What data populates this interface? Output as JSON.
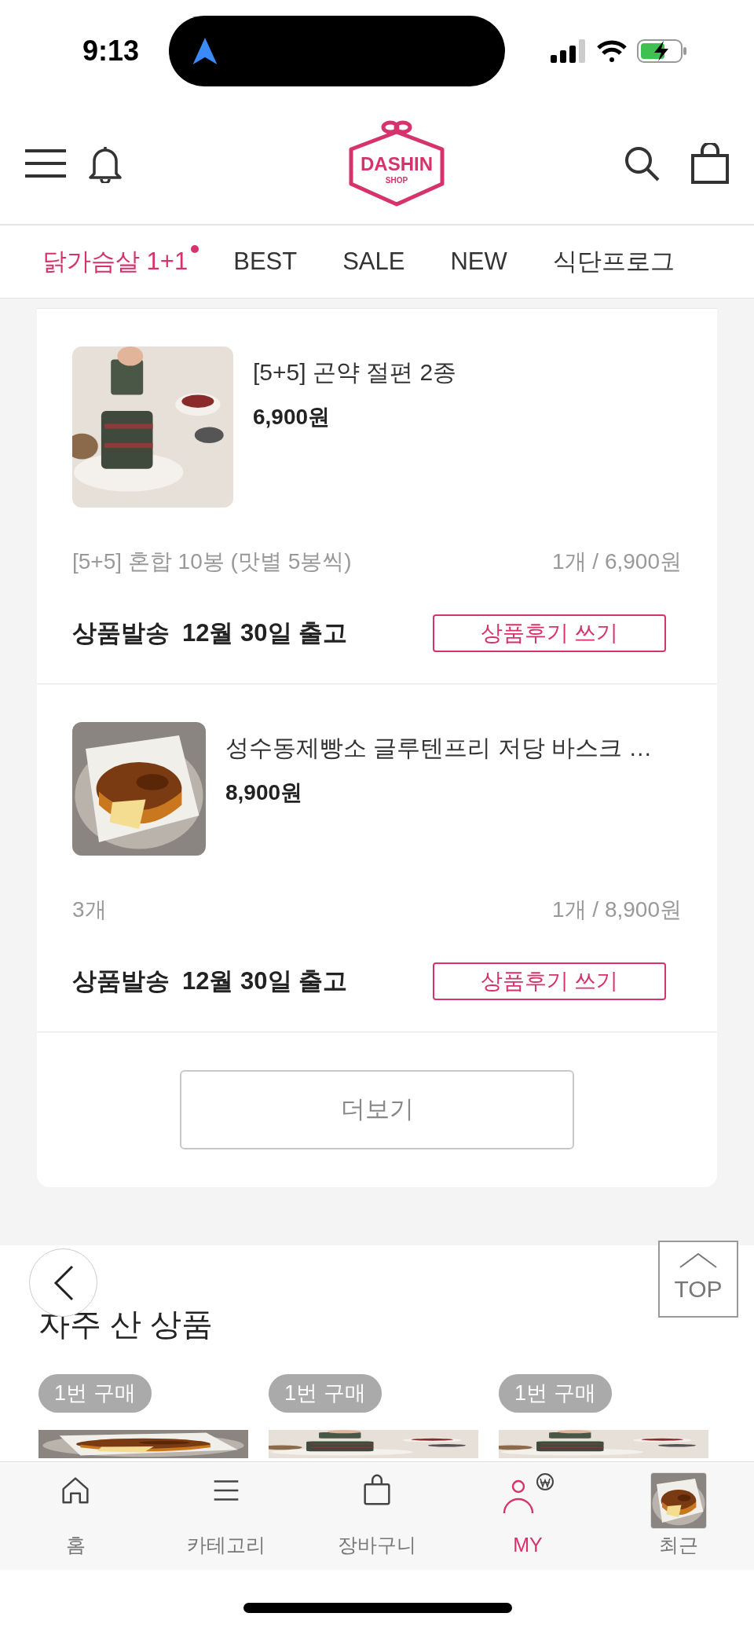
{
  "status_bar": {
    "time": "9:13"
  },
  "header": {
    "logo": {
      "name": "DASHIN",
      "sub": "SHOP"
    }
  },
  "nav_tabs": [
    {
      "label": "닭가슴살 1+1",
      "selected": true,
      "dot": true
    },
    {
      "label": "BEST",
      "selected": false,
      "dot": false
    },
    {
      "label": "SALE",
      "selected": false,
      "dot": false
    },
    {
      "label": "NEW",
      "selected": false,
      "dot": false
    },
    {
      "label": "식단프로그",
      "selected": false,
      "dot": false
    }
  ],
  "orders": [
    {
      "title": "[5+5] 곤약 절편 2종",
      "price": "6,900원",
      "option": "[5+5] 혼합 10봉 (맛별 5봉씩)",
      "quantity": "1개 / 6,900원",
      "shipping_label": "상품발송",
      "shipping_date": "12월 30일 출고",
      "review_button": "상품후기 쓰기",
      "kind": "tteok"
    },
    {
      "title": "성수동제빵소 글루텐프리 저당 바스크 …",
      "price": "8,900원",
      "option": "3개",
      "quantity": "1개 / 8,900원",
      "shipping_label": "상품발송",
      "shipping_date": "12월 30일 출고",
      "review_button": "상품후기 쓰기",
      "kind": "cake"
    }
  ],
  "more_button": "더보기",
  "frequent": {
    "title": "자주 산 상품",
    "items": [
      {
        "badge": "1번 구매"
      },
      {
        "badge": "1번 구매"
      },
      {
        "badge": "1번 구매"
      }
    ]
  },
  "top_button": "TOP",
  "bottom_nav": [
    {
      "label": "홈",
      "kind": "home",
      "selected": false
    },
    {
      "label": "카테고리",
      "kind": "menu",
      "selected": false
    },
    {
      "label": "장바구니",
      "kind": "bag",
      "selected": false
    },
    {
      "label": "MY",
      "kind": "user",
      "selected": true
    },
    {
      "label": "최근",
      "kind": "recent",
      "selected": false
    }
  ]
}
